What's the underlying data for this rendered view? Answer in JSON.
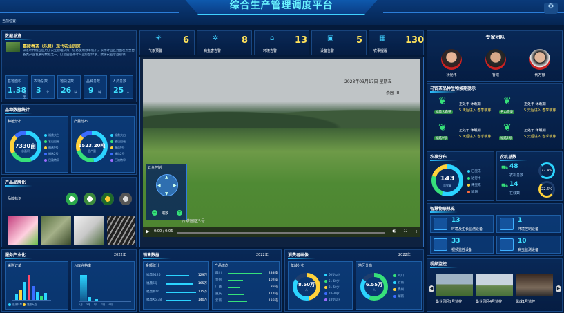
{
  "header": {
    "title": "综合生产管理调度平台",
    "location": "当前位置："
  },
  "alerts": [
    {
      "label": "气象预警",
      "value": "6"
    },
    {
      "label": "病虫害告警",
      "value": "8"
    },
    {
      "label": "环境告警",
      "value": "13"
    },
    {
      "label": "设备告警",
      "value": "5"
    },
    {
      "label": "农事提醒",
      "value": "130"
    }
  ],
  "base": {
    "section_title": "数据总览",
    "name": "嘉陵春茶（乐泉）现代农业园区",
    "desc": "以茶叶种植园区用于农业管理决策，信息使用效率低下，以茶叶园区为出发点整合各类产业发展的数据之一，打造园区茶叶产业综合体系，数字农业示范引领……",
    "stats": [
      {
        "label": "基地面积",
        "value": "1.38",
        "unit": "万亩"
      },
      {
        "label": "农场总数",
        "value": "3",
        "unit": "个"
      },
      {
        "label": "地块总数",
        "value": "26",
        "unit": "块"
      },
      {
        "label": "品种总数",
        "value": "9",
        "unit": "种"
      },
      {
        "label": "人员总数",
        "value": "25",
        "unit": "人"
      }
    ]
  },
  "variety": {
    "section_title": "品种数据统计",
    "plant": {
      "title": "种植分布",
      "value": "7330亩",
      "sub": "总面积",
      "legend": [
        "福鼎大白",
        "名山白毫",
        "福选9号",
        "福选2号",
        "巴渝特早"
      ]
    },
    "yield": {
      "title": "产量分布",
      "value": "1523.20吨",
      "sub": "总产量",
      "legend": [
        "福鼎大白",
        "名山白毫",
        "福选9号",
        "福选2号",
        "巴渝特早"
      ]
    }
  },
  "brand": {
    "section_title": "产品品牌化",
    "label": "品牌标识"
  },
  "video": {
    "title_overlay": "2023年03月17日 星期五",
    "sub_overlay": "茶园 III",
    "time": "0:00 / 0:06",
    "camera": "台茶园区5号",
    "ptz_title": "云台控制",
    "zoom_label": "缩放"
  },
  "experts": {
    "section_title": "专家团队",
    "people": [
      {
        "name": "杨光伟"
      },
      {
        "name": "鲁成"
      },
      {
        "name": "代万银"
      }
    ]
  },
  "tips": {
    "section_title": "马铃茶品种生物候期提示",
    "items": [
      {
        "name": "福鼎大白茶",
        "line1": "正处于 休眠期",
        "line2": "5 天后进入 春季萌芽"
      },
      {
        "name": "名山白毫",
        "line1": "正处于 休眠期",
        "line2": "5 天后进入 春季萌芽"
      },
      {
        "name": "福选9号",
        "line1": "正处于 休眠期",
        "line2": "5 天后进入 春季萌芽"
      },
      {
        "name": "福选2号",
        "line1": "正处于 休眠期",
        "line2": "5 天后进入 春季萌芽"
      }
    ]
  },
  "farm": {
    "section_title": "农事分布",
    "total": "143",
    "sub": "总农事",
    "legend": [
      "已完成",
      "进行中",
      "未完成",
      "逾期"
    ],
    "activity_title": "农机总数",
    "a1": "48",
    "a1l": "农机总数",
    "a2": "14",
    "a2l": "在线数",
    "p1": "77.4%",
    "p2": "22.6%"
  },
  "devices": {
    "section_title": "智慧物联总览",
    "items": [
      {
        "value": "13",
        "label": "环境及生长监测设备"
      },
      {
        "value": "1",
        "label": "环境控制设备"
      },
      {
        "value": "33",
        "label": "视频监控设备"
      },
      {
        "value": "10",
        "label": "病虫监测设备"
      }
    ]
  },
  "cams": {
    "section_title": "视频监控",
    "items": [
      {
        "label": "桑业园区9号监控"
      },
      {
        "label": "桑业园区4号监控"
      },
      {
        "label": "黑成1号监控"
      }
    ]
  },
  "bottom": {
    "prod": {
      "section_title": "服务产业化",
      "year": "2022年",
      "c1": "采购订单",
      "c2": "入库合格率",
      "legend": [
        "巴渝特早",
        "福鼎大白",
        "名山白毫",
        "福选9号"
      ],
      "axis_x": [
        "1月",
        "3月",
        "5月",
        "7月",
        "9月",
        "11月"
      ]
    },
    "sales": {
      "section_title": "销售数据",
      "year": "2022年",
      "left_title": "金额统计",
      "right_title": "产品流向",
      "left": [
        {
          "name": "福鼎9426",
          "value": "129万"
        },
        {
          "name": "福鼎6号",
          "value": "165万"
        },
        {
          "name": "福鼎特早",
          "value": "175万"
        },
        {
          "name": "福鼎X5.38",
          "value": "140万"
        }
      ],
      "right": [
        {
          "name": "四川",
          "value": "238吨"
        },
        {
          "name": "贵州",
          "value": "102吨"
        },
        {
          "name": "广西",
          "value": "85吨"
        },
        {
          "name": "重庆",
          "value": "112吨"
        },
        {
          "name": "云南",
          "value": "135吨"
        }
      ]
    },
    "consumer": {
      "section_title": "消费者画像",
      "year": "2022年",
      "age_title": "年龄分布",
      "age_value": "8.50万",
      "age_sub": "人",
      "ages": [
        "60岁以上",
        "51-60岁",
        "31-50岁",
        "18-30岁",
        "18岁以下"
      ],
      "region_title": "地区分布",
      "region_value": "6.55万",
      "region_sub": "人",
      "regions": [
        "四川",
        "云南",
        "贵州",
        "湖南"
      ]
    }
  }
}
